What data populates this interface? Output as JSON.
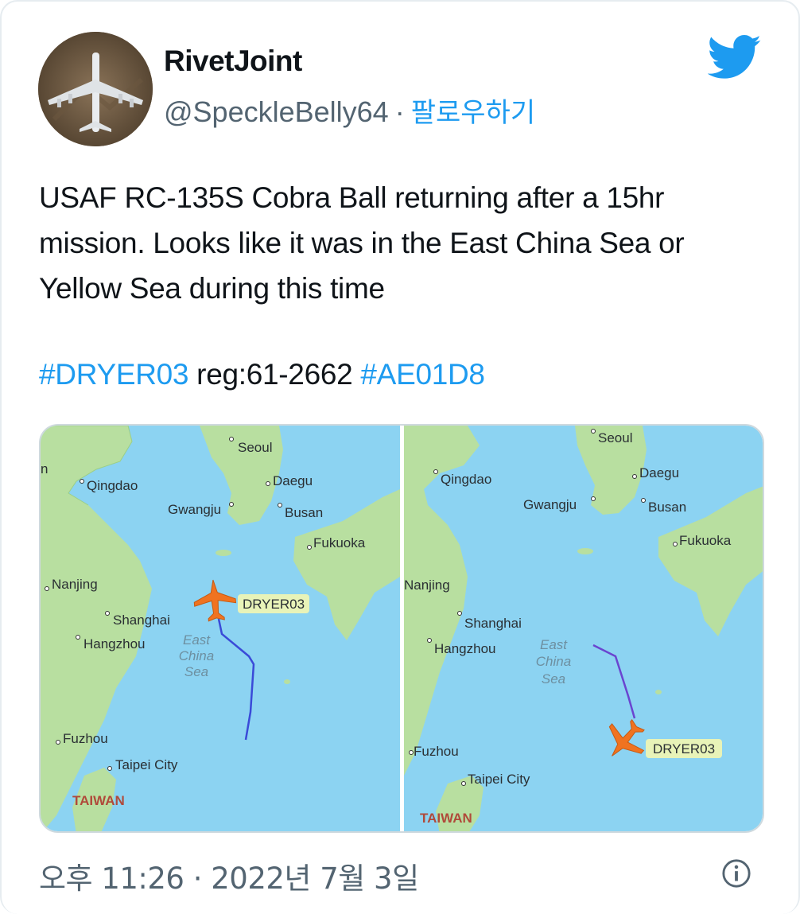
{
  "tweet": {
    "display_name": "RivetJoint",
    "handle": "@SpeckleBelly64",
    "separator": "·",
    "follow_label": "팔로우하기",
    "text": "USAF RC-135S Cobra Ball returning after a 15hr mission. Looks like it was in the East China Sea or Yellow Sea during this time",
    "hashtag_1": "#DRYER03",
    "reg_text": "reg:61-2662",
    "hashtag_2": "#AE01D8",
    "timestamp": "오후 11:26 · 2022년 7월 3일"
  },
  "icons": {
    "brand": "twitter-bird-icon",
    "info": "info-icon",
    "avatar": "aircraft-photo"
  },
  "colors": {
    "accent": "#1d9bf0",
    "sea": "#8cd3f2",
    "land": "#b8dfa0",
    "plane": "#f07320",
    "track": "#3a4ad8"
  },
  "maps": {
    "left": {
      "cut_label": "n",
      "labels": {
        "seoul": "Seoul",
        "qingdao": "Qingdao",
        "daegu": "Daegu",
        "gwangju": "Gwangju",
        "busan": "Busan",
        "fukuoka": "Fukuoka",
        "nanjing": "Nanjing",
        "shanghai": "Shanghai",
        "hangzhou": "Hangzhou",
        "fuzhou": "Fuzhou",
        "taipei": "Taipei City",
        "taiwan": "TAIWAN",
        "sea1": "East",
        "sea2": "China",
        "sea3": "Sea",
        "callsign": "DRYER03"
      }
    },
    "right": {
      "labels": {
        "seoul": "Seoul",
        "qingdao": "Qingdao",
        "daegu": "Daegu",
        "gwangju": "Gwangju",
        "busan": "Busan",
        "fukuoka": "Fukuoka",
        "nanjing": "Nanjing",
        "shanghai": "Shanghai",
        "hangzhou": "Hangzhou",
        "fuzhou": "Fuzhou",
        "taipei": "Taipei City",
        "taiwan": "TAIWAN",
        "sea1": "East",
        "sea2": "China",
        "sea3": "Sea",
        "callsign": "DRYER03"
      }
    }
  }
}
